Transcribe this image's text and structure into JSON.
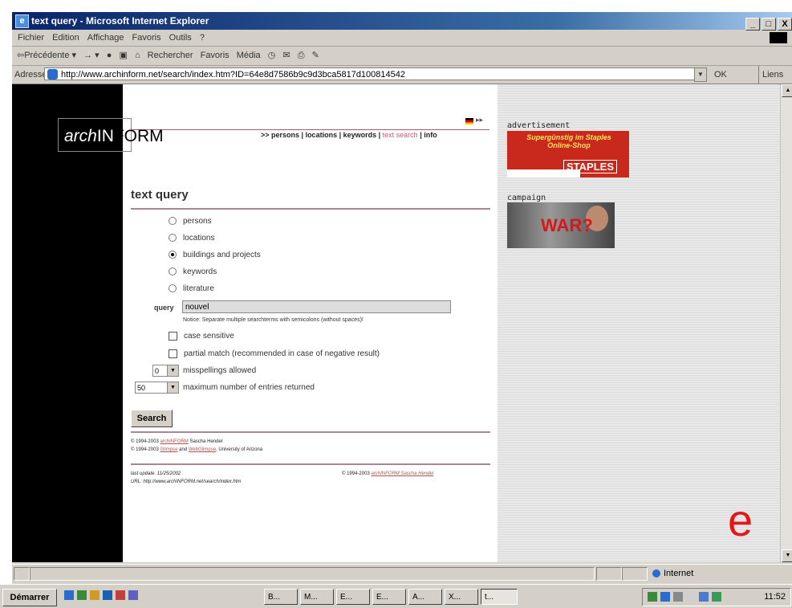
{
  "window": {
    "title": "text query - Microsoft Internet Explorer",
    "buttons": [
      "_",
      "□",
      "X"
    ]
  },
  "menu": [
    "Fichier",
    "Edition",
    "Affichage",
    "Favoris",
    "Outils",
    "?"
  ],
  "toolbar": {
    "back": "⇦Précédente ▾",
    "forward": "→ ▾",
    "search": "Rechercher",
    "favorites": "Favoris",
    "media": "Média"
  },
  "address": {
    "label": "Adresse",
    "url": "http://www.archinform.net/search/index.htm?ID=64e8d7586b9c9d3bca5817d100814542",
    "go": "OK",
    "links": "Liens"
  },
  "site": {
    "logo_a": "arch",
    "logo_b": "IN",
    "logo_c": "FORM",
    "nav_prefix": ">> ",
    "nav": [
      "persons",
      "locations",
      "keywords",
      "text search",
      "info"
    ],
    "lang_arrow": "▸▸"
  },
  "form": {
    "title": "text query",
    "radios": [
      {
        "label": "persons",
        "checked": false
      },
      {
        "label": "locations",
        "checked": false
      },
      {
        "label": "buildings and projects",
        "checked": true
      },
      {
        "label": "keywords",
        "checked": false
      },
      {
        "label": "literature",
        "checked": false
      }
    ],
    "query_label": "query",
    "query_value": "nouvel",
    "notice": "Notice: Separate multiple searchterms with semicolons (without spaces)!",
    "case_sensitive": "case sensitive",
    "partial_match": "partial match (recommended in case of negative result)",
    "misspellings_value": "0",
    "misspellings_label": "misspellings allowed",
    "max_value": "50",
    "max_label": "maximum number of entries returned",
    "search_button": "Search"
  },
  "footer": {
    "line1_prefix": "© 1994-2003 ",
    "line1_link": "archINFORM",
    "line1_suffix": " Sascha Hendel",
    "line2_prefix": "© 1994-2003 ",
    "line2_link1": "Glimpse",
    "line2_mid": " and ",
    "line2_link2": "WebGlimpse",
    "line2_suffix": ", University of Arizona",
    "last_update": "last update: 11/25/2002",
    "url": "URL: http://www.archINFORM.net/search/index.htm",
    "copyright2_prefix": "© 1994-2003 ",
    "copyright2_link": "archINFORM Sascha Hendel"
  },
  "sidebar": {
    "ad_label": "advertisement",
    "ad_text1": "Supergünstig im Staples Online-Shop",
    "ad_text2": "STAPLES",
    "campaign_label": "campaign",
    "campaign_text": "WAR?"
  },
  "ie_logo": "e",
  "status": {
    "zone": "Internet"
  },
  "taskbar": {
    "start": "Démarrer",
    "buttons": [
      "B...",
      "M...",
      "E...",
      "E...",
      "A...",
      "X...",
      "t..."
    ],
    "clock": "11:52"
  }
}
